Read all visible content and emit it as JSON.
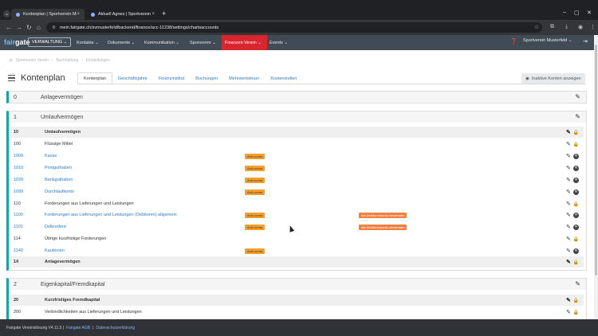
{
  "browser": {
    "tabs": [
      {
        "title": "Kontenplan | Sportverein Musterfe",
        "active": true
      },
      {
        "title": "Aktuell Agnes | Sportverein Muster",
        "active": false
      }
    ],
    "url": "mein.fairgate.ch/svmusterfeld/backend/finance/acc-11238/settings/chartsaccounts"
  },
  "header": {
    "logo_a": "fair",
    "logo_b": "gate",
    "mode_label": "VERWALTUNG",
    "menu": [
      {
        "label": "Kontakte ⌄"
      },
      {
        "label": "Dokumente ⌄"
      },
      {
        "label": "Kommunikation ⌄"
      },
      {
        "label": "Sponsoren ⌄"
      },
      {
        "label": "Finanzen Verein ⌄"
      },
      {
        "label": "Events ⌄"
      }
    ],
    "org_name": "Sportverein Musterfeld ⌄"
  },
  "breadcrumb": [
    "Sportverein Verein",
    "Buchhaltung",
    "Einstellungen"
  ],
  "page": {
    "title": "Kontenplan",
    "tabs": [
      "Kontenplan",
      "Geschäftsjahre",
      "Finanzinstitut",
      "Buchungen",
      "Mehrwertsteuer",
      "Kostenstellen"
    ],
    "inactive_button": "Inaktive Konten anzeigen"
  },
  "blocks": [
    {
      "num": "0",
      "title": "Anlagevermögen"
    },
    {
      "num": "1",
      "title": "Umlaufvermögen"
    },
    {
      "num": "2",
      "title": "Eigenkapital/Fremdkapital"
    }
  ],
  "rows": [
    {
      "code": "10",
      "name": "Umlaufvermögen",
      "type": "group",
      "badge": "",
      "badge2": ""
    },
    {
      "code": "100",
      "name": "Flüssige Mittel",
      "type": "sub",
      "badge": "",
      "badge2": ""
    },
    {
      "code": "1000",
      "name": "Kasse",
      "type": "link",
      "badge": "Anti-vorma",
      "badge2": ""
    },
    {
      "code": "1010",
      "name": "Postguthaben",
      "type": "link",
      "badge": "Anti-vorma",
      "badge2": ""
    },
    {
      "code": "1020",
      "name": "Bankguthaben",
      "type": "link",
      "badge": "Anti-vorma",
      "badge2": ""
    },
    {
      "code": "1099",
      "name": "Durchlaufkonto",
      "type": "link",
      "badge": "Anti-vorma",
      "badge2": ""
    },
    {
      "code": "110",
      "name": "Forderungen aus Lieferungen und Leistungen",
      "type": "sub",
      "badge": "",
      "badge2": ""
    },
    {
      "code": "1100",
      "name": "Forderungen aus Lieferungen und Leistungen (Debitoren) allgemein",
      "type": "link",
      "badge": "Anti-vorma",
      "badge2": "Als Debitorenkonto verwenden"
    },
    {
      "code": "1101",
      "name": "Delkredere",
      "type": "link",
      "badge": "Anti-vorma",
      "badge2": "Als Debitorenkonto verwenden"
    },
    {
      "code": "114",
      "name": "Übrige kurzfristige Forderungen",
      "type": "sub",
      "badge": "",
      "badge2": ""
    },
    {
      "code": "1140",
      "name": "Kautionen",
      "type": "link",
      "badge": "Anti-vorma",
      "badge2": ""
    },
    {
      "code": "14",
      "name": "Anlagevermögen",
      "type": "group",
      "badge": "",
      "badge2": ""
    },
    {
      "code": "20",
      "name": "Kurzfristiges Fremdkapital",
      "type": "group",
      "badge": "",
      "badge2": ""
    },
    {
      "code": "200",
      "name": "Verbindlichkeiten aus Lieferungen und Leistungen",
      "type": "sub",
      "badge": "",
      "badge2": ""
    }
  ],
  "footer": {
    "version": "Fairgate Vereinslösung V4.11.5 |",
    "agb": "Fairgate AGB",
    "sep": "|",
    "privacy": "Datenschutzerklärung"
  }
}
